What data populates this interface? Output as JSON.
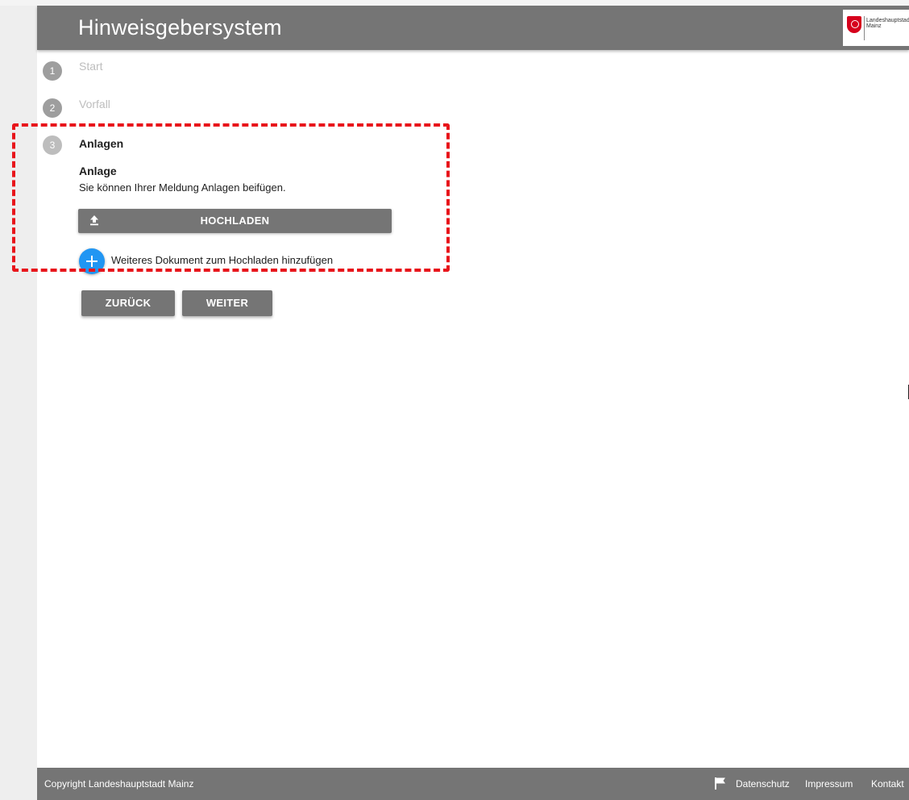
{
  "header": {
    "title": "Hinweisgebersystem",
    "logo_text": "Landeshauptstadt\nMainz"
  },
  "stepper": {
    "steps": [
      {
        "number": "1",
        "label": "Start",
        "state": "done"
      },
      {
        "number": "2",
        "label": "Vorfall",
        "state": "done"
      },
      {
        "number": "3",
        "label": "Anlagen",
        "state": "active"
      }
    ]
  },
  "attachments": {
    "title": "Anlage",
    "description": "Sie können Ihrer Meldung Anlagen beifügen.",
    "upload_label": "HOCHLADEN",
    "add_document_label": "Weiteres Dokument zum Hochladen hinzufügen"
  },
  "navigation": {
    "back_label": "ZURÜCK",
    "next_label": "WEITER"
  },
  "footer": {
    "copyright": "Copyright Landeshauptstadt Mainz",
    "links": [
      "Datenschutz",
      "Impressum",
      "Kontakt"
    ]
  },
  "colors": {
    "header_bg": "#757575",
    "accent_blue": "#2196f3",
    "highlight_red": "#e8151b"
  }
}
